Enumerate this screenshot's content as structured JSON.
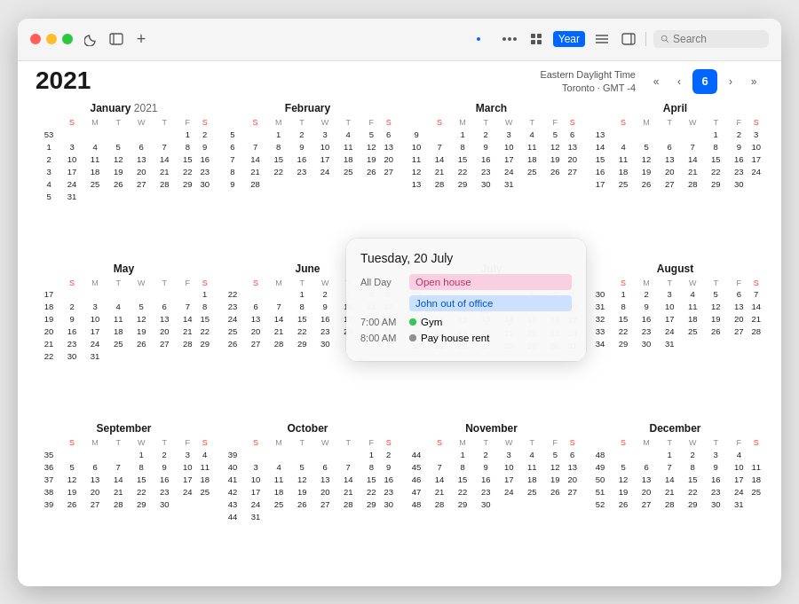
{
  "window": {
    "title": "Calendar",
    "year": "2021"
  },
  "titlebar": {
    "traffic_lights": [
      "red",
      "yellow",
      "green"
    ],
    "icons": [
      "moon",
      "sidebar",
      "plus"
    ],
    "views": [
      "dot",
      "dots",
      "grid",
      "year",
      "list",
      "sidebar-right"
    ],
    "year_label": "Year",
    "search_placeholder": "Search"
  },
  "nav": {
    "timezone": "Eastern Daylight Time",
    "city": "Toronto · GMT -4",
    "today": "6",
    "prev_prev": "«",
    "prev": "‹",
    "next": "›",
    "next_next": "»"
  },
  "months": [
    {
      "name": "January",
      "year": "2021",
      "show_year": true,
      "days": [
        "S",
        "M",
        "T",
        "W",
        "T",
        "F",
        "S"
      ],
      "weeks": [
        {
          "wn": "53",
          "days": [
            "",
            "",
            "",
            "",
            "",
            "1",
            "2"
          ]
        },
        {
          "wn": "1",
          "days": [
            "3",
            "4",
            "5",
            "6",
            "7",
            "8",
            "9"
          ]
        },
        {
          "wn": "2",
          "days": [
            "10",
            "11",
            "12",
            "13",
            "14",
            "15",
            "16"
          ]
        },
        {
          "wn": "3",
          "days": [
            "17",
            "18",
            "19",
            "20",
            "21",
            "22",
            "23"
          ]
        },
        {
          "wn": "4",
          "days": [
            "24",
            "25",
            "26",
            "27",
            "28",
            "29",
            "30"
          ]
        },
        {
          "wn": "5",
          "days": [
            "31",
            "",
            "",
            "",
            "",
            "",
            ""
          ]
        }
      ]
    },
    {
      "name": "February",
      "year": "",
      "show_year": false,
      "days": [
        "S",
        "M",
        "T",
        "W",
        "T",
        "F",
        "S"
      ],
      "weeks": [
        {
          "wn": "5",
          "days": [
            "",
            "1",
            "2",
            "3",
            "4",
            "5",
            "6"
          ]
        },
        {
          "wn": "6",
          "days": [
            "7",
            "8",
            "9",
            "10",
            "11",
            "12",
            "13"
          ]
        },
        {
          "wn": "7",
          "days": [
            "14",
            "15",
            "16",
            "17",
            "18",
            "19",
            "20"
          ]
        },
        {
          "wn": "8",
          "days": [
            "21",
            "22",
            "23",
            "24",
            "25",
            "26",
            "27"
          ]
        },
        {
          "wn": "9",
          "days": [
            "28",
            "",
            "",
            "",
            "",
            "",
            ""
          ]
        }
      ]
    },
    {
      "name": "March",
      "year": "",
      "show_year": false,
      "days": [
        "S",
        "M",
        "T",
        "W",
        "T",
        "F",
        "S"
      ],
      "weeks": [
        {
          "wn": "9",
          "days": [
            "",
            "1",
            "2",
            "3",
            "4",
            "5",
            "6"
          ]
        },
        {
          "wn": "10",
          "days": [
            "7",
            "8",
            "9",
            "10",
            "11",
            "12",
            "13"
          ]
        },
        {
          "wn": "11",
          "days": [
            "14",
            "15",
            "16",
            "17",
            "18",
            "19",
            "20"
          ]
        },
        {
          "wn": "12",
          "days": [
            "21",
            "22",
            "23",
            "24",
            "25",
            "26",
            "27"
          ]
        },
        {
          "wn": "13",
          "days": [
            "28",
            "29",
            "30",
            "31",
            "",
            "",
            ""
          ]
        }
      ]
    },
    {
      "name": "April",
      "year": "",
      "show_year": false,
      "days": [
        "S",
        "M",
        "T",
        "W",
        "T",
        "F",
        "S"
      ],
      "weeks": [
        {
          "wn": "13",
          "days": [
            "",
            "",
            "",
            "",
            "1",
            "2",
            "3"
          ]
        },
        {
          "wn": "14",
          "days": [
            "4",
            "5",
            "6",
            "7",
            "8",
            "9",
            "10"
          ]
        },
        {
          "wn": "15",
          "days": [
            "11",
            "12",
            "13",
            "14",
            "15",
            "16",
            "17"
          ]
        },
        {
          "wn": "16",
          "days": [
            "18",
            "19",
            "20",
            "21",
            "22",
            "23",
            "24"
          ]
        },
        {
          "wn": "17",
          "days": [
            "25",
            "26",
            "27",
            "28",
            "29",
            "30",
            ""
          ]
        }
      ]
    },
    {
      "name": "May",
      "year": "",
      "show_year": false,
      "days": [
        "S",
        "M",
        "T",
        "W",
        "T",
        "F",
        "S"
      ],
      "weeks": [
        {
          "wn": "17",
          "days": [
            "",
            "",
            "",
            "",
            "",
            "",
            "1"
          ]
        },
        {
          "wn": "18",
          "days": [
            "2",
            "3",
            "4",
            "5",
            "6",
            "7",
            "8"
          ]
        },
        {
          "wn": "19",
          "days": [
            "9",
            "10",
            "11",
            "12",
            "13",
            "14",
            "15"
          ]
        },
        {
          "wn": "20",
          "days": [
            "16",
            "17",
            "18",
            "19",
            "20",
            "21",
            "22"
          ]
        },
        {
          "wn": "21",
          "days": [
            "23",
            "24",
            "25",
            "26",
            "27",
            "28",
            "29"
          ]
        },
        {
          "wn": "22",
          "days": [
            "30",
            "31",
            "",
            "",
            "",
            "",
            ""
          ]
        }
      ]
    },
    {
      "name": "June",
      "year": "",
      "show_year": false,
      "days": [
        "S",
        "M",
        "T",
        "W",
        "T",
        "F",
        "S"
      ],
      "weeks": [
        {
          "wn": "22",
          "days": [
            "",
            "",
            "1",
            "2",
            "3",
            "4",
            "5"
          ]
        },
        {
          "wn": "23",
          "days": [
            "6",
            "7",
            "8",
            "9",
            "10",
            "11",
            "12"
          ]
        },
        {
          "wn": "24",
          "days": [
            "13",
            "14",
            "15",
            "16",
            "17",
            "18",
            "19"
          ]
        },
        {
          "wn": "25",
          "days": [
            "20",
            "21",
            "22",
            "23",
            "24",
            "25",
            "26"
          ]
        },
        {
          "wn": "26",
          "days": [
            "27",
            "28",
            "29",
            "30",
            "",
            "",
            ""
          ]
        }
      ]
    },
    {
      "name": "July",
      "year": "",
      "show_year": false,
      "days": [
        "S",
        "M",
        "T",
        "W",
        "T",
        "F",
        "S"
      ],
      "weeks": [
        {
          "wn": "26",
          "days": [
            "",
            "",
            "",
            "",
            "1",
            "2",
            "3"
          ]
        },
        {
          "wn": "27",
          "days": [
            "4",
            "5",
            "6",
            "7",
            "8",
            "9",
            "10"
          ]
        },
        {
          "wn": "28",
          "days": [
            "11",
            "12",
            "13",
            "14",
            "15",
            "16",
            "17"
          ]
        },
        {
          "wn": "29",
          "days": [
            "18",
            "19",
            "20",
            "21",
            "22",
            "23",
            "24"
          ]
        },
        {
          "wn": "30",
          "days": [
            "25",
            "26",
            "27",
            "28",
            "29",
            "30",
            "31"
          ]
        }
      ]
    },
    {
      "name": "August",
      "year": "",
      "show_year": false,
      "days": [
        "S",
        "M",
        "T",
        "W",
        "T",
        "F",
        "S"
      ],
      "weeks": [
        {
          "wn": "30",
          "days": [
            "1",
            "2",
            "3",
            "4",
            "5",
            "6",
            "7"
          ]
        },
        {
          "wn": "31",
          "days": [
            "8",
            "9",
            "10",
            "11",
            "12",
            "13",
            "14"
          ]
        },
        {
          "wn": "32",
          "days": [
            "15",
            "16",
            "17",
            "18",
            "19",
            "20",
            "21"
          ]
        },
        {
          "wn": "33",
          "days": [
            "22",
            "23",
            "24",
            "25",
            "26",
            "27",
            "28"
          ]
        },
        {
          "wn": "34",
          "days": [
            "29",
            "30",
            "31",
            "",
            "",
            "",
            ""
          ]
        }
      ]
    },
    {
      "name": "September",
      "year": "",
      "show_year": false,
      "days": [
        "S",
        "M",
        "T",
        "W",
        "T",
        "F",
        "S"
      ],
      "weeks": [
        {
          "wn": "35",
          "days": [
            "",
            "",
            "",
            "1",
            "2",
            "3",
            "4"
          ]
        },
        {
          "wn": "36",
          "days": [
            "5",
            "6",
            "7",
            "8",
            "9",
            "10",
            "11"
          ]
        },
        {
          "wn": "37",
          "days": [
            "12",
            "13",
            "14",
            "15",
            "16",
            "17",
            "18"
          ]
        },
        {
          "wn": "38",
          "days": [
            "19",
            "20",
            "21",
            "22",
            "23",
            "24",
            "25"
          ]
        },
        {
          "wn": "39",
          "days": [
            "26",
            "27",
            "28",
            "29",
            "30",
            "",
            ""
          ]
        }
      ]
    },
    {
      "name": "October",
      "year": "",
      "show_year": false,
      "days": [
        "S",
        "M",
        "T",
        "W",
        "T",
        "F",
        "S"
      ],
      "weeks": [
        {
          "wn": "39",
          "days": [
            "",
            "",
            "",
            "",
            "",
            "1",
            "2"
          ]
        },
        {
          "wn": "40",
          "days": [
            "3",
            "4",
            "5",
            "6",
            "7",
            "8",
            "9"
          ]
        },
        {
          "wn": "41",
          "days": [
            "10",
            "11",
            "12",
            "13",
            "14",
            "15",
            "16"
          ]
        },
        {
          "wn": "42",
          "days": [
            "17",
            "18",
            "19",
            "20",
            "21",
            "22",
            "23"
          ]
        },
        {
          "wn": "43",
          "days": [
            "24",
            "25",
            "26",
            "27",
            "28",
            "29",
            "30"
          ]
        },
        {
          "wn": "44",
          "days": [
            "31",
            "",
            "",
            "",
            "",
            "",
            ""
          ]
        }
      ]
    },
    {
      "name": "November",
      "year": "",
      "show_year": false,
      "days": [
        "S",
        "M",
        "T",
        "W",
        "T",
        "F",
        "S"
      ],
      "weeks": [
        {
          "wn": "44",
          "days": [
            "",
            "1",
            "2",
            "3",
            "4",
            "5",
            "6"
          ]
        },
        {
          "wn": "45",
          "days": [
            "7",
            "8",
            "9",
            "10",
            "11",
            "12",
            "13"
          ]
        },
        {
          "wn": "46",
          "days": [
            "14",
            "15",
            "16",
            "17",
            "18",
            "19",
            "20"
          ]
        },
        {
          "wn": "47",
          "days": [
            "21",
            "22",
            "23",
            "24",
            "25",
            "26",
            "27"
          ]
        },
        {
          "wn": "48",
          "days": [
            "28",
            "29",
            "30",
            "",
            "",
            "",
            ""
          ]
        }
      ]
    },
    {
      "name": "December",
      "year": "",
      "show_year": false,
      "days": [
        "S",
        "M",
        "T",
        "W",
        "T",
        "F",
        "S"
      ],
      "weeks": [
        {
          "wn": "48",
          "days": [
            "",
            "",
            "1",
            "2",
            "3",
            "4"
          ]
        },
        {
          "wn": "49",
          "days": [
            "5",
            "6",
            "7",
            "8",
            "9",
            "10",
            "11"
          ]
        },
        {
          "wn": "50",
          "days": [
            "12",
            "13",
            "14",
            "15",
            "16",
            "17",
            "18"
          ]
        },
        {
          "wn": "51",
          "days": [
            "19",
            "20",
            "21",
            "22",
            "23",
            "24",
            "25"
          ]
        },
        {
          "wn": "52",
          "days": [
            "26",
            "27",
            "28",
            "29",
            "30",
            "31",
            ""
          ]
        }
      ]
    }
  ],
  "popup": {
    "title": "Tuesday,",
    "date": " 20 July",
    "events": [
      {
        "time": "All Day",
        "label": "Open house",
        "type": "bar",
        "color": "pink"
      },
      {
        "time": "",
        "label": "John out of office",
        "type": "bar",
        "color": "blue"
      },
      {
        "time": "7:00 AM",
        "label": "Gym",
        "type": "dot",
        "dot_color": "green"
      },
      {
        "time": "8:00 AM",
        "label": "Pay house rent",
        "type": "dot",
        "dot_color": "gray"
      }
    ]
  }
}
